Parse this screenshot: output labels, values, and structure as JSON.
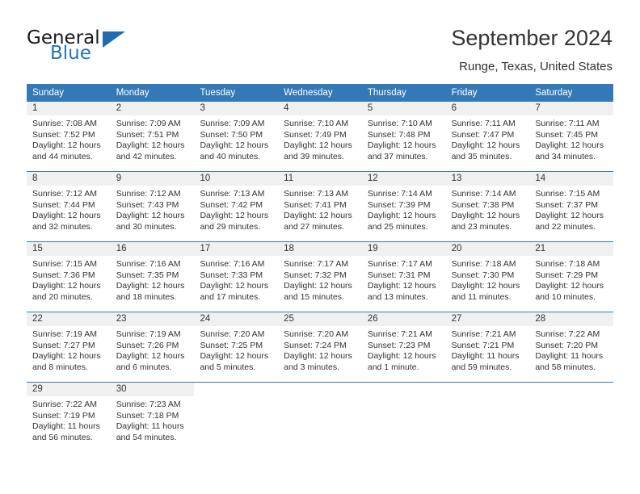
{
  "brand": {
    "name_top": "General",
    "name_bottom": "Blue",
    "triangle_icon": "triangle-icon",
    "color_dark": "#1a1a1a",
    "color_blue": "#2275bb"
  },
  "header": {
    "title": "September 2024",
    "subtitle": "Runge, Texas, United States"
  },
  "theme": {
    "header_blue": "#3479b7",
    "day_band_gray": "#f0f0f0",
    "text": "#333333"
  },
  "weekdays": [
    "Sunday",
    "Monday",
    "Tuesday",
    "Wednesday",
    "Thursday",
    "Friday",
    "Saturday"
  ],
  "weeks": [
    [
      {
        "day": "1",
        "sunrise": "Sunrise: 7:08 AM",
        "sunset": "Sunset: 7:52 PM",
        "daylight": "Daylight: 12 hours and 44 minutes."
      },
      {
        "day": "2",
        "sunrise": "Sunrise: 7:09 AM",
        "sunset": "Sunset: 7:51 PM",
        "daylight": "Daylight: 12 hours and 42 minutes."
      },
      {
        "day": "3",
        "sunrise": "Sunrise: 7:09 AM",
        "sunset": "Sunset: 7:50 PM",
        "daylight": "Daylight: 12 hours and 40 minutes."
      },
      {
        "day": "4",
        "sunrise": "Sunrise: 7:10 AM",
        "sunset": "Sunset: 7:49 PM",
        "daylight": "Daylight: 12 hours and 39 minutes."
      },
      {
        "day": "5",
        "sunrise": "Sunrise: 7:10 AM",
        "sunset": "Sunset: 7:48 PM",
        "daylight": "Daylight: 12 hours and 37 minutes."
      },
      {
        "day": "6",
        "sunrise": "Sunrise: 7:11 AM",
        "sunset": "Sunset: 7:47 PM",
        "daylight": "Daylight: 12 hours and 35 minutes."
      },
      {
        "day": "7",
        "sunrise": "Sunrise: 7:11 AM",
        "sunset": "Sunset: 7:45 PM",
        "daylight": "Daylight: 12 hours and 34 minutes."
      }
    ],
    [
      {
        "day": "8",
        "sunrise": "Sunrise: 7:12 AM",
        "sunset": "Sunset: 7:44 PM",
        "daylight": "Daylight: 12 hours and 32 minutes."
      },
      {
        "day": "9",
        "sunrise": "Sunrise: 7:12 AM",
        "sunset": "Sunset: 7:43 PM",
        "daylight": "Daylight: 12 hours and 30 minutes."
      },
      {
        "day": "10",
        "sunrise": "Sunrise: 7:13 AM",
        "sunset": "Sunset: 7:42 PM",
        "daylight": "Daylight: 12 hours and 29 minutes."
      },
      {
        "day": "11",
        "sunrise": "Sunrise: 7:13 AM",
        "sunset": "Sunset: 7:41 PM",
        "daylight": "Daylight: 12 hours and 27 minutes."
      },
      {
        "day": "12",
        "sunrise": "Sunrise: 7:14 AM",
        "sunset": "Sunset: 7:39 PM",
        "daylight": "Daylight: 12 hours and 25 minutes."
      },
      {
        "day": "13",
        "sunrise": "Sunrise: 7:14 AM",
        "sunset": "Sunset: 7:38 PM",
        "daylight": "Daylight: 12 hours and 23 minutes."
      },
      {
        "day": "14",
        "sunrise": "Sunrise: 7:15 AM",
        "sunset": "Sunset: 7:37 PM",
        "daylight": "Daylight: 12 hours and 22 minutes."
      }
    ],
    [
      {
        "day": "15",
        "sunrise": "Sunrise: 7:15 AM",
        "sunset": "Sunset: 7:36 PM",
        "daylight": "Daylight: 12 hours and 20 minutes."
      },
      {
        "day": "16",
        "sunrise": "Sunrise: 7:16 AM",
        "sunset": "Sunset: 7:35 PM",
        "daylight": "Daylight: 12 hours and 18 minutes."
      },
      {
        "day": "17",
        "sunrise": "Sunrise: 7:16 AM",
        "sunset": "Sunset: 7:33 PM",
        "daylight": "Daylight: 12 hours and 17 minutes."
      },
      {
        "day": "18",
        "sunrise": "Sunrise: 7:17 AM",
        "sunset": "Sunset: 7:32 PM",
        "daylight": "Daylight: 12 hours and 15 minutes."
      },
      {
        "day": "19",
        "sunrise": "Sunrise: 7:17 AM",
        "sunset": "Sunset: 7:31 PM",
        "daylight": "Daylight: 12 hours and 13 minutes."
      },
      {
        "day": "20",
        "sunrise": "Sunrise: 7:18 AM",
        "sunset": "Sunset: 7:30 PM",
        "daylight": "Daylight: 12 hours and 11 minutes."
      },
      {
        "day": "21",
        "sunrise": "Sunrise: 7:18 AM",
        "sunset": "Sunset: 7:29 PM",
        "daylight": "Daylight: 12 hours and 10 minutes."
      }
    ],
    [
      {
        "day": "22",
        "sunrise": "Sunrise: 7:19 AM",
        "sunset": "Sunset: 7:27 PM",
        "daylight": "Daylight: 12 hours and 8 minutes."
      },
      {
        "day": "23",
        "sunrise": "Sunrise: 7:19 AM",
        "sunset": "Sunset: 7:26 PM",
        "daylight": "Daylight: 12 hours and 6 minutes."
      },
      {
        "day": "24",
        "sunrise": "Sunrise: 7:20 AM",
        "sunset": "Sunset: 7:25 PM",
        "daylight": "Daylight: 12 hours and 5 minutes."
      },
      {
        "day": "25",
        "sunrise": "Sunrise: 7:20 AM",
        "sunset": "Sunset: 7:24 PM",
        "daylight": "Daylight: 12 hours and 3 minutes."
      },
      {
        "day": "26",
        "sunrise": "Sunrise: 7:21 AM",
        "sunset": "Sunset: 7:23 PM",
        "daylight": "Daylight: 12 hours and 1 minute."
      },
      {
        "day": "27",
        "sunrise": "Sunrise: 7:21 AM",
        "sunset": "Sunset: 7:21 PM",
        "daylight": "Daylight: 11 hours and 59 minutes."
      },
      {
        "day": "28",
        "sunrise": "Sunrise: 7:22 AM",
        "sunset": "Sunset: 7:20 PM",
        "daylight": "Daylight: 11 hours and 58 minutes."
      }
    ],
    [
      {
        "day": "29",
        "sunrise": "Sunrise: 7:22 AM",
        "sunset": "Sunset: 7:19 PM",
        "daylight": "Daylight: 11 hours and 56 minutes."
      },
      {
        "day": "30",
        "sunrise": "Sunrise: 7:23 AM",
        "sunset": "Sunset: 7:18 PM",
        "daylight": "Daylight: 11 hours and 54 minutes."
      },
      {
        "day": "",
        "sunrise": "",
        "sunset": "",
        "daylight": ""
      },
      {
        "day": "",
        "sunrise": "",
        "sunset": "",
        "daylight": ""
      },
      {
        "day": "",
        "sunrise": "",
        "sunset": "",
        "daylight": ""
      },
      {
        "day": "",
        "sunrise": "",
        "sunset": "",
        "daylight": ""
      },
      {
        "day": "",
        "sunrise": "",
        "sunset": "",
        "daylight": ""
      }
    ]
  ]
}
